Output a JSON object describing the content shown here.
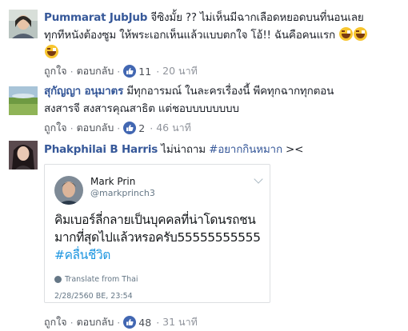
{
  "comments": [
    {
      "author": "Pummarat JubJub",
      "line1": " จีซิงมั้ย ?? ไม่เห็นมีฉากเลือดหยอดบนที่นอนเลย",
      "line2": "ทุกทีหนังต้องซูม ให้พระเอกเห็นแล้วแบบตกใจ โอ้!! ฉันคือคนแรก",
      "like_label": "ถูกใจ",
      "reply_label": "ตอบกลับ",
      "likes": "11",
      "time": "20 นาที"
    },
    {
      "author": "สุกัญญา อนุมาตร",
      "line1": " มีทุกอารมณ์ ในละครเรื่องนี้ พีคทุกฉากทุกตอน",
      "line2": "สงสารจี สงสารคุณสาธิต แต่ชอบบบบบบบบ",
      "like_label": "ถูกใจ",
      "reply_label": "ตอบกลับ",
      "likes": "2",
      "time": "46 นาที"
    },
    {
      "author": "Phakphilai B Harris",
      "text": " ไม่น่าถาม ",
      "hashtag": "#อยากกินหมาก",
      "suffix": " ><",
      "like_label": "ถูกใจ",
      "reply_label": "ตอบกลับ",
      "likes": "48",
      "time": "31 นาที"
    }
  ],
  "embed": {
    "name": "Mark Prin",
    "handle": "@markprinch3",
    "line1": "คิมเบอร์ลี่กลายเป็นบุคคลที่น่าโดนรถชน",
    "line2": "มากที่สุดไปแล้วหรอครับ55555555555",
    "hashtag": "#คลื่นชีวิต",
    "translate": "Translate from Thai",
    "date": "2/28/2560 BE, 23:54"
  },
  "colors": {
    "link": "#365899",
    "like_badge": "#4267b2",
    "tw_hashtag": "#1b95e0"
  }
}
